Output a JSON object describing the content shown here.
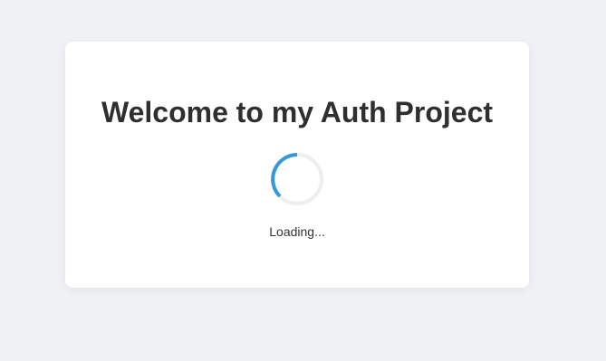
{
  "page": {
    "title": "Welcome to my Auth Project",
    "loading_text": "Loading...",
    "spinner_icon": "loading-spinner-icon"
  },
  "colors": {
    "background": "#f0f1f4",
    "card": "#ffffff",
    "title": "#2f2f2f",
    "spinner_track": "#eeeeee",
    "spinner_accent": "#3498db"
  }
}
